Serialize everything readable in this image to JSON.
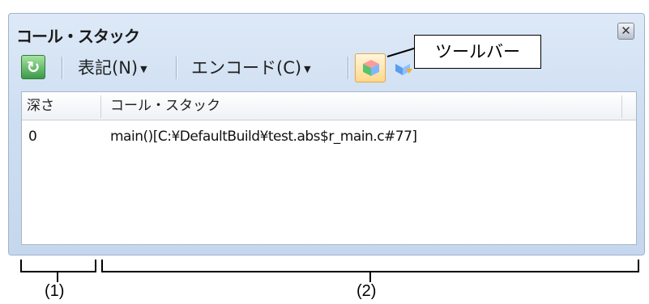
{
  "panel": {
    "title": "コール・スタック",
    "close_glyph": "✕"
  },
  "toolbar": {
    "refresh_glyph": "↻",
    "notation_label": "表記(N)",
    "encode_label": "エンコード(C)",
    "dropdown_caret": "▼"
  },
  "table": {
    "columns": [
      "深さ",
      "コール・スタック"
    ],
    "rows": [
      {
        "depth": "0",
        "call_stack": "main()[C:¥DefaultBuild¥test.abs$r_main.c#77]"
      }
    ]
  },
  "callout": {
    "text": "ツールバー"
  },
  "annotations": {
    "label_1": "(1)",
    "label_2": "(2)"
  }
}
